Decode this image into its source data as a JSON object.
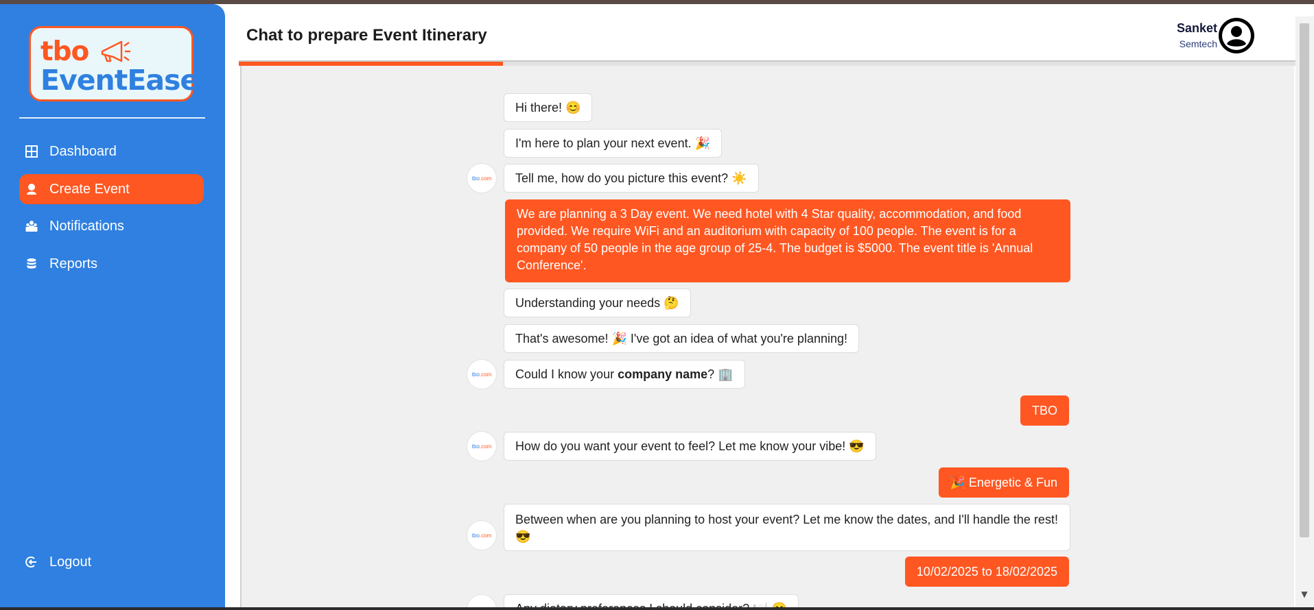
{
  "brand": {
    "logo_line1": "tbo",
    "logo_line2": "EventEase"
  },
  "sidebar": {
    "items": [
      {
        "label": "Dashboard",
        "icon": "grid-icon"
      },
      {
        "label": "Create Event",
        "icon": "create-event-icon",
        "active": true
      },
      {
        "label": "Notifications",
        "icon": "people-icon"
      },
      {
        "label": "Reports",
        "icon": "database-icon"
      }
    ],
    "logout_label": "Logout"
  },
  "header": {
    "title": "Chat to prepare Event Itinerary",
    "user_name": "Sanket",
    "user_org": "Semtech",
    "progress": 0.25
  },
  "bot_avatar": {
    "text_a": "tbo",
    "text_b": ".com"
  },
  "chat": {
    "messages": [
      {
        "from": "bot",
        "text": "Hi there! 😊"
      },
      {
        "from": "bot",
        "text": "I'm here to plan your next event. 🎉"
      },
      {
        "from": "bot",
        "text": "Tell me, how do you picture this event? ☀️"
      },
      {
        "from": "user",
        "text": "We are planning a 3 Day event. We need hotel with 4 Star quality, accommodation, and food provided. We require WiFi and an auditorium with capacity of 100 people. The event is for a company of 50 people in the age group of 25-4. The budget is $5000. The event title is 'Annual Conference'."
      },
      {
        "from": "bot",
        "text": "Understanding your needs 🤔"
      },
      {
        "from": "bot",
        "text": "That's awesome! 🎉 I've got an idea of what you're planning!"
      },
      {
        "from": "bot",
        "text_before": "Could I know your ",
        "text_bold": "company name",
        "text_after": "? 🏢"
      },
      {
        "from": "user",
        "text": "TBO"
      },
      {
        "from": "bot",
        "text": "How do you want your event to feel? Let me know your vibe! 😎"
      },
      {
        "from": "user",
        "text": "🎉 Energetic & Fun"
      },
      {
        "from": "bot",
        "text": "Between when are you planning to host your event? Let me know the dates, and I'll handle the rest! 😎"
      },
      {
        "from": "user",
        "text": "10/02/2025 to 18/02/2025"
      },
      {
        "from": "bot",
        "text": "Any dietary preferences I should consider? 🍽️ 😊"
      }
    ]
  },
  "colors": {
    "sidebar": "#2f80e0",
    "accent": "#ff5722",
    "chat_bg": "#f0f0f0"
  }
}
